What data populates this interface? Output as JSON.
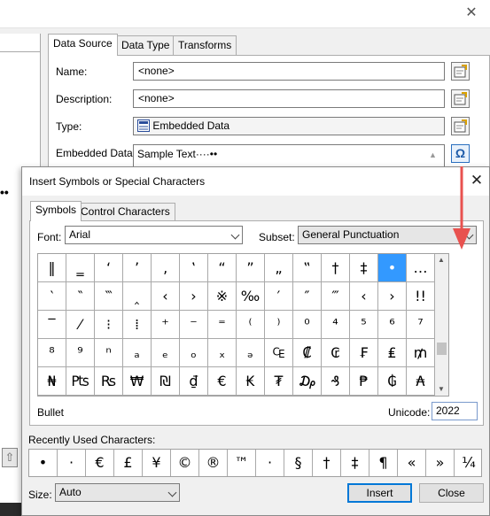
{
  "background_dialog": {
    "tabs": [
      "Data Source",
      "Data Type",
      "Transforms"
    ],
    "fields": {
      "name_label": "Name:",
      "name_value": "<none>",
      "description_label": "Description:",
      "description_value": "<none>",
      "type_label": "Type:",
      "type_value": "Embedded Data",
      "embedded_label": "Embedded Data:",
      "embedded_value": "Sample Text····••"
    },
    "symbol_button_glyph": "Ω"
  },
  "symbols_dialog": {
    "title": "Insert Symbols or Special Characters",
    "tabs": [
      "Symbols",
      "Control Characters"
    ],
    "font_label": "Font:",
    "font_value": "Arial",
    "subset_label": "Subset:",
    "subset_value": "General Punctuation",
    "grid": [
      [
        "‖",
        "‗",
        "‘",
        "’",
        "‚",
        "‛",
        "“",
        "”",
        "„",
        "‟",
        "†",
        "‡",
        "•",
        "…"
      ],
      [
        "‵",
        "‶",
        "‷",
        "‸",
        "‹",
        "›",
        "※",
        "‰",
        "′",
        "″",
        "‴",
        "‹",
        "›",
        "!!",
        "‽"
      ],
      [
        "‾",
        "⁄",
        "⁝",
        "⁞",
        "⁺",
        "⁻",
        "⁼",
        "⁽",
        "⁾",
        "⁰",
        "⁴",
        "⁵",
        "⁶",
        "⁷"
      ],
      [
        "⁸",
        "⁹",
        "ⁿ",
        "ₐ",
        "ₑ",
        "ₒ",
        "ₓ",
        "ₔ",
        "₠",
        "₡",
        "₢",
        "₣",
        "₤",
        "₥"
      ],
      [
        "₦",
        "₧",
        "₨",
        "₩",
        "₪",
        "₫",
        "€",
        "₭",
        "₮",
        "₯",
        "₰",
        "₱",
        "₲",
        "₳"
      ]
    ],
    "selected_char_name": "Bullet",
    "unicode_label": "Unicode:",
    "unicode_value": "2022",
    "recent_label": "Recently Used Characters:",
    "recent": [
      "•",
      "·",
      "€",
      "£",
      "¥",
      "©",
      "®",
      "™",
      "·",
      "§",
      "†",
      "‡",
      "¶",
      "«",
      "»",
      "¼"
    ],
    "size_label": "Size:",
    "size_value": "Auto",
    "insert_label": "Insert",
    "close_label": "Close"
  },
  "colors": {
    "selection": "#3399ff",
    "arrow": "#e8524f",
    "default_button_border": "#0078d7"
  }
}
